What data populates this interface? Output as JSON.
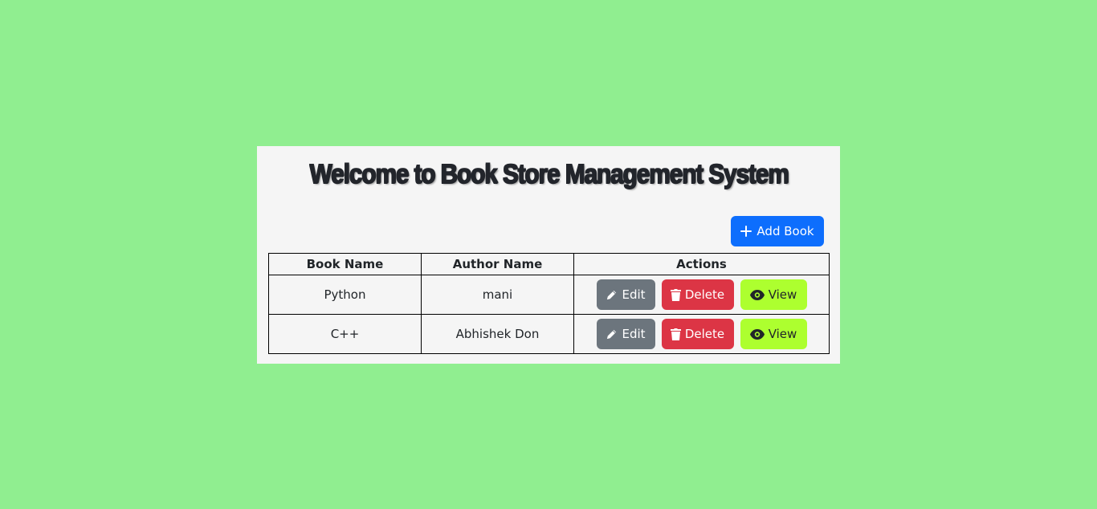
{
  "header": {
    "title": "Welcome to Book Store Management System"
  },
  "toolbar": {
    "add_label": "Add Book",
    "add_icon": "plus-icon"
  },
  "table": {
    "columns": [
      "Book Name",
      "Author Name",
      "Actions"
    ],
    "rows": [
      {
        "book_name": "Python",
        "author_name": "mani"
      },
      {
        "book_name": "C++",
        "author_name": "Abhishek Don"
      }
    ],
    "actions": {
      "edit_label": "Edit",
      "edit_icon": "pencil-icon",
      "delete_label": "Delete",
      "delete_icon": "trash-icon",
      "view_label": "View",
      "view_icon": "eye-icon"
    }
  },
  "colors": {
    "page_background": "#90ee90",
    "card_background": "#f5f5f5",
    "primary": "#0d6efd",
    "secondary": "#6c757d",
    "danger": "#dc3545",
    "view": "#adff2f"
  }
}
